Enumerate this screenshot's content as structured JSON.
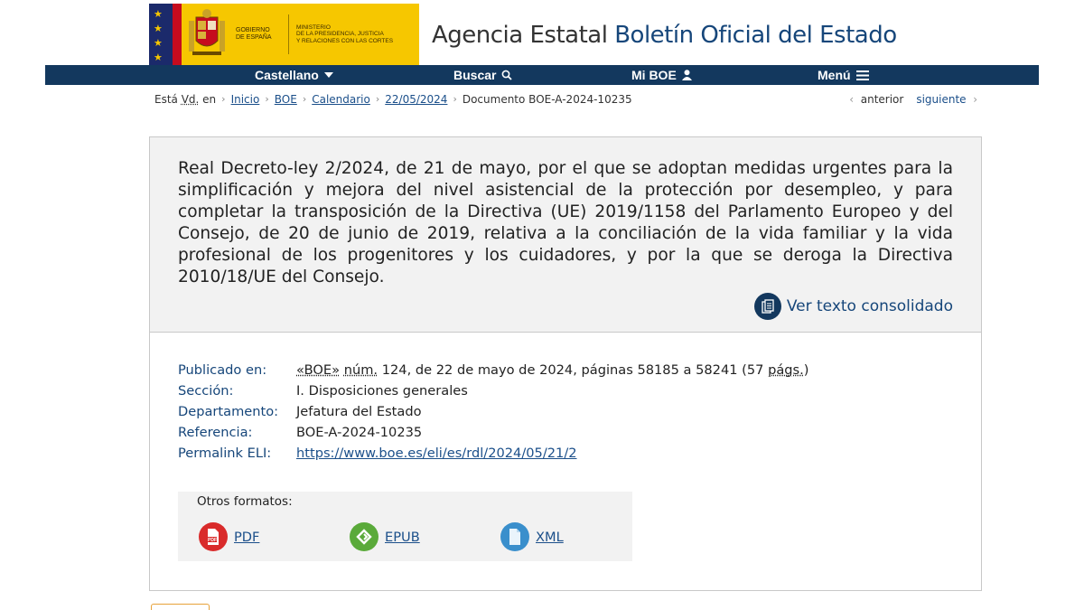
{
  "header": {
    "gov_line1": "Gobierno",
    "gov_line2": "de España",
    "ministry_line1": "Ministerio",
    "ministry_line2": "de la Presidencia, Justicia",
    "ministry_line3": "y Relaciones con las Cortes",
    "agency_prefix": "Agencia Estatal ",
    "agency_name": "Boletín Oficial del Estado"
  },
  "navbar": {
    "language": "Castellano",
    "search": "Buscar",
    "my_boe": "Mi BOE",
    "menu": "Menú"
  },
  "breadcrumb": {
    "intro_prefix": "Está ",
    "intro_abbr": "Vd.",
    "intro_suffix": " en",
    "items": [
      "Inicio",
      "BOE",
      "Calendario",
      "22/05/2024"
    ],
    "current": "Documento BOE-A-2024-10235"
  },
  "pager": {
    "prev": "anterior",
    "next": "siguiente"
  },
  "document": {
    "title": "Real Decreto-ley 2/2024, de 21 de mayo, por el que se adoptan medidas urgentes para la simplificación y mejora del nivel asistencial de la protección por desempleo, y para completar la transposición de la Directiva (UE) 2019/1158 del Parlamento Europeo y del Consejo, de 20 de junio de 2019, relativa a la conciliación de la vida familiar y la vida profesional de los progenitores y los cuidadores, y por la que se deroga la Directiva 2010/18/UE del Consejo.",
    "consolidated_link": "Ver texto consolidado"
  },
  "meta": {
    "published_label": "Publicado en:",
    "published_boe": "«BOE»",
    "published_num": "núm.",
    "published_rest": " 124, de 22 de mayo de 2024, páginas 58185 a 58241 (57 ",
    "published_pags": "págs.",
    "published_close": ")",
    "section_label": "Sección:",
    "section_value": "I. Disposiciones generales",
    "department_label": "Departamento:",
    "department_value": "Jefatura del Estado",
    "reference_label": "Referencia:",
    "reference_value": "BOE-A-2024-10235",
    "eli_label": "Permalink ELI:",
    "eli_value": "https://www.boe.es/eli/es/rdl/2024/05/21/2"
  },
  "formats": {
    "title": "Otros formatos:",
    "items": [
      {
        "label": "PDF",
        "icon": "pdf-icon",
        "color": "#d92b2b"
      },
      {
        "label": "EPUB",
        "icon": "epub-icon",
        "color": "#5aaa3a"
      },
      {
        "label": "XML",
        "icon": "xml-icon",
        "color": "#3a8fcc"
      }
    ]
  },
  "colors": {
    "navbar": "#13385e",
    "logo_yellow": "#f6c700",
    "link_blue": "#1b4f8a",
    "head_bg": "#f2f2f2"
  }
}
